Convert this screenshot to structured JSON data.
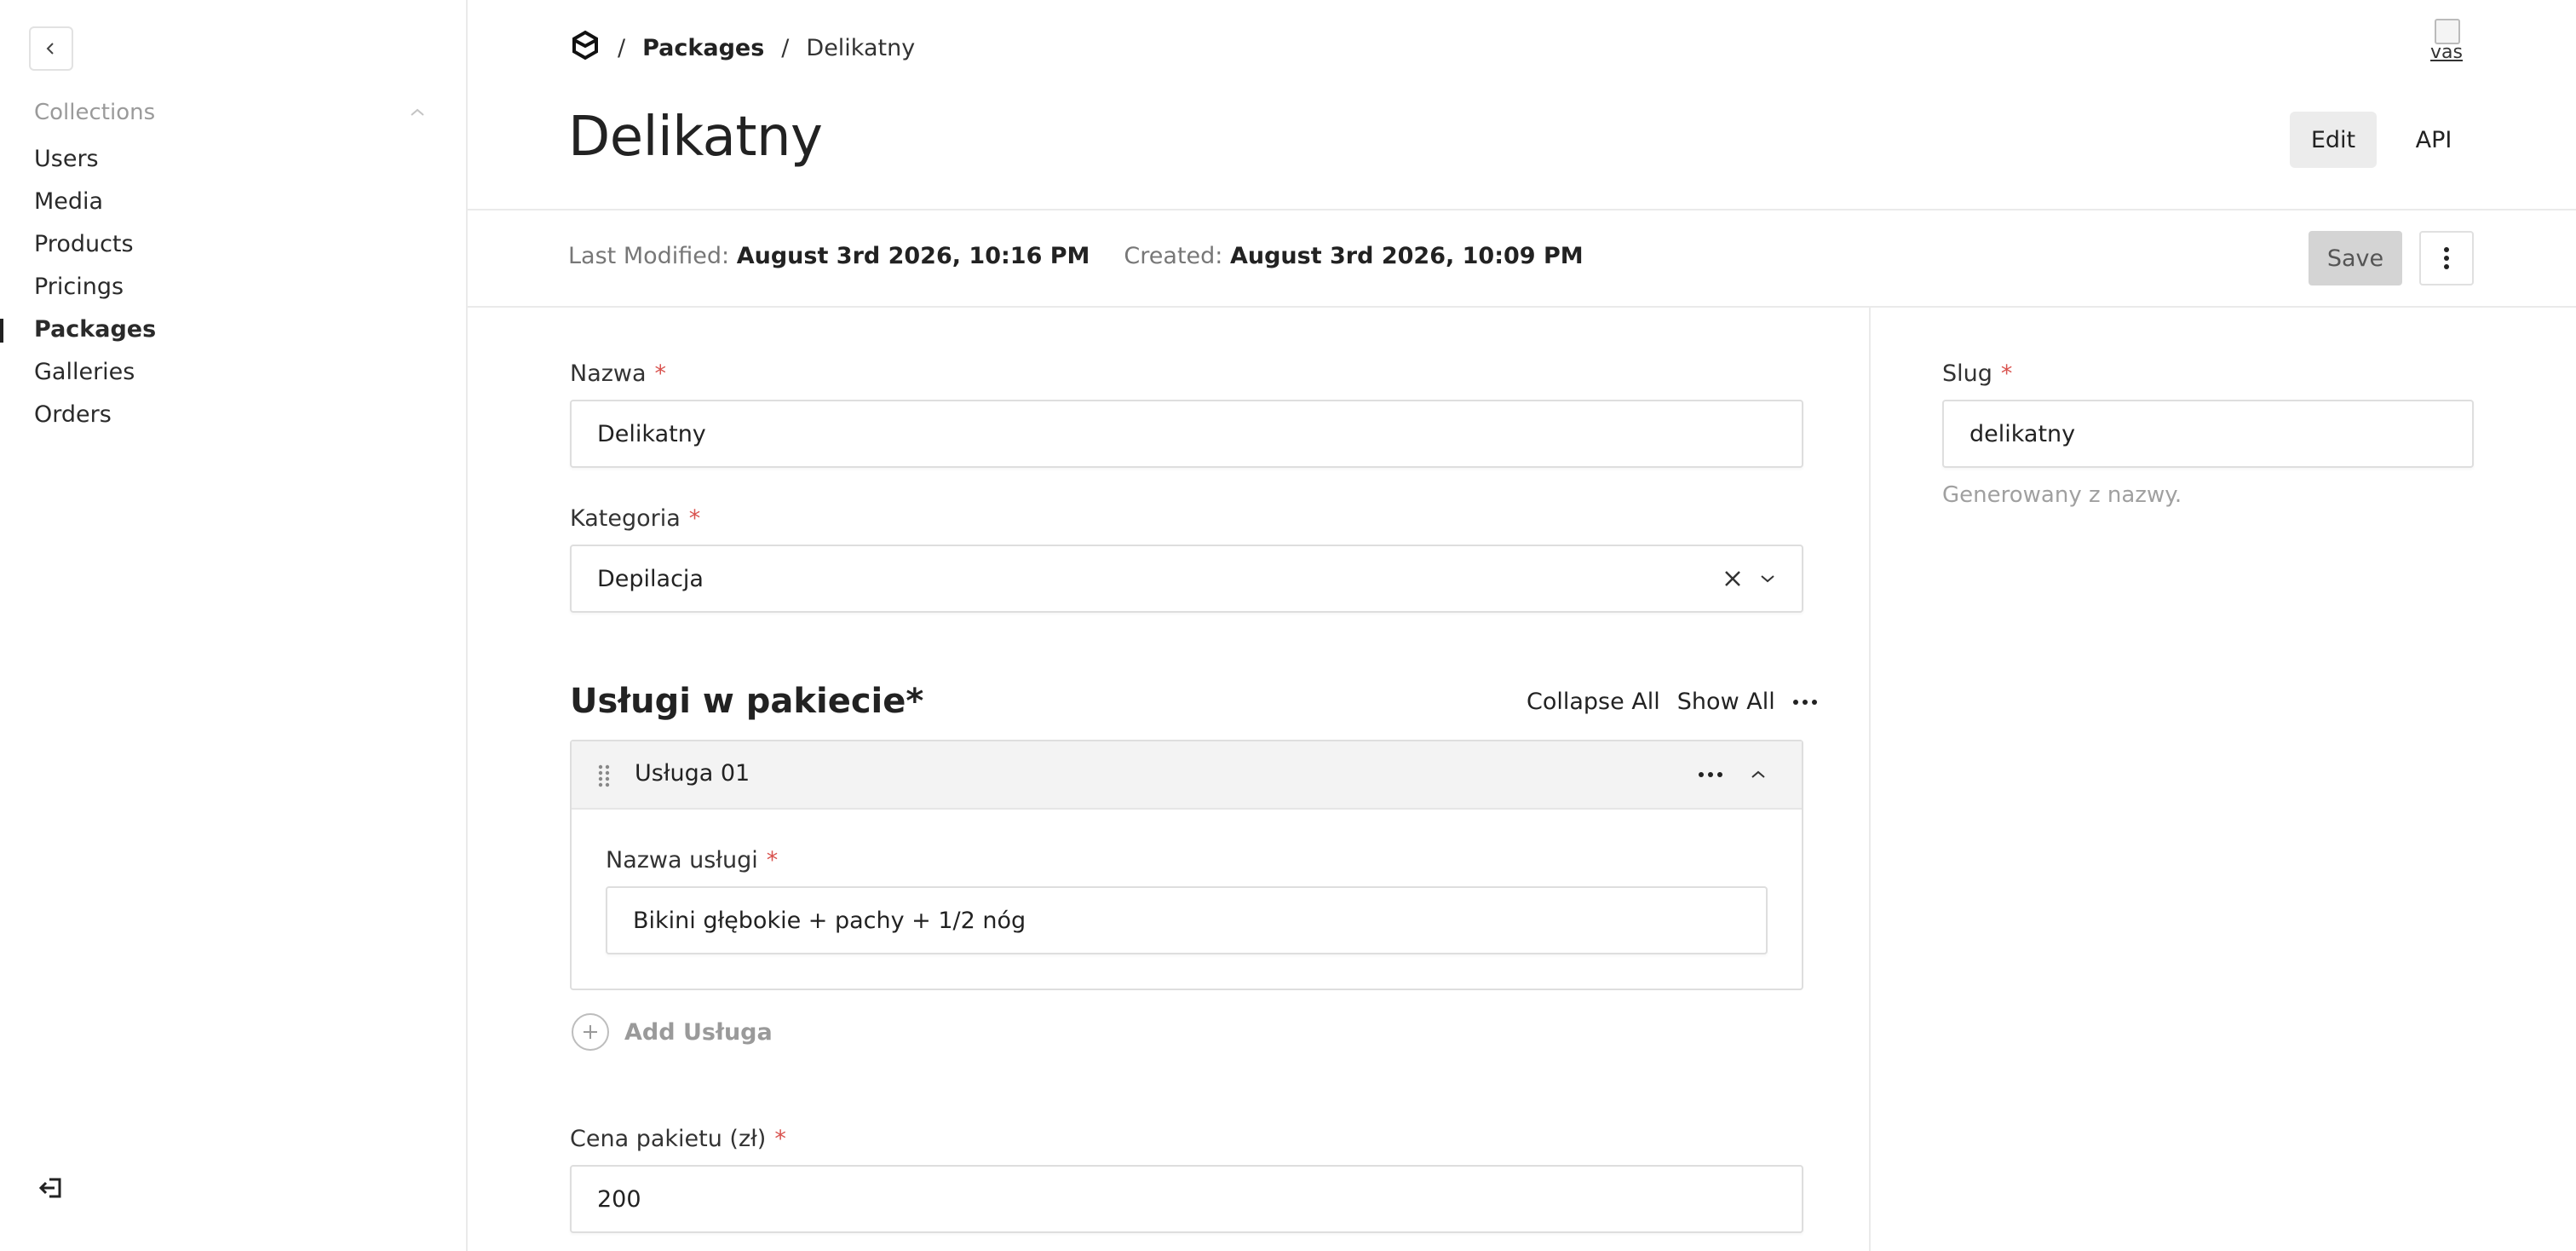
{
  "sidebar": {
    "collections_label": "Collections",
    "items": [
      {
        "label": "Users"
      },
      {
        "label": "Media"
      },
      {
        "label": "Products"
      },
      {
        "label": "Pricings"
      },
      {
        "label": "Packages",
        "active": true
      },
      {
        "label": "Galleries"
      },
      {
        "label": "Orders"
      }
    ]
  },
  "breadcrumb": {
    "separator": "/",
    "collection": "Packages",
    "current": "Delikatny"
  },
  "avatar": {
    "alt_text": "vas"
  },
  "header": {
    "title": "Delikatny",
    "tabs": {
      "edit": "Edit",
      "api": "API"
    }
  },
  "meta": {
    "last_modified_label": "Last Modified:",
    "last_modified_value": "August 3rd 2026, 10:16 PM",
    "created_label": "Created:",
    "created_value": "August 3rd 2026, 10:09 PM",
    "save_label": "Save"
  },
  "form": {
    "nazwa": {
      "label": "Nazwa",
      "required": "*",
      "value": "Delikatny"
    },
    "kategoria": {
      "label": "Kategoria",
      "required": "*",
      "value": "Depilacja"
    },
    "uslugi": {
      "title": "Usługi w pakiecie*",
      "collapse_all": "Collapse All",
      "show_all": "Show All",
      "blocks": [
        {
          "title": "Usługa 01",
          "field_label": "Nazwa usługi",
          "required": "*",
          "value": "Bikini głębokie + pachy + 1/2 nóg"
        }
      ],
      "add_label": "Add Usługa"
    },
    "cena": {
      "label": "Cena pakietu (zł)",
      "required": "*",
      "value": "200"
    }
  },
  "sidebar_fields": {
    "slug": {
      "label": "Slug",
      "required": "*",
      "value": "delikatny",
      "hint": "Generowany z nazwy."
    }
  },
  "colors": {
    "accent": "#222222",
    "required": "#d9534f",
    "muted": "#9a9a9a",
    "border": "#dedede"
  }
}
